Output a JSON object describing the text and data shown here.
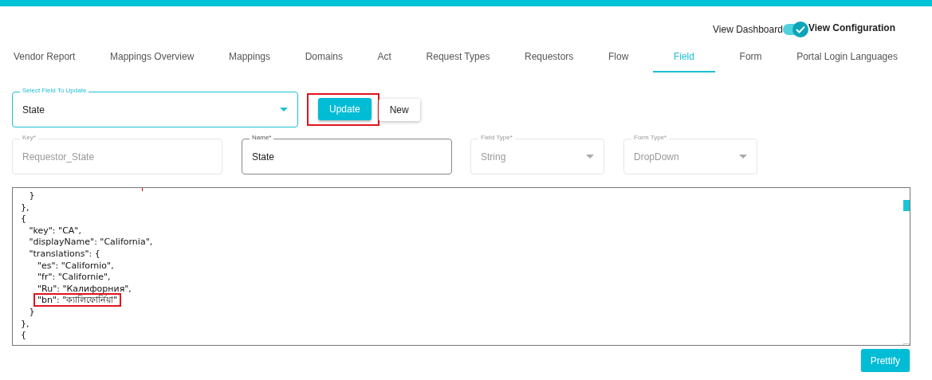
{
  "view_toggle": {
    "left_label": "View Dashboard",
    "right_label": "View Configuration",
    "on": true
  },
  "tabs": [
    {
      "label": "Vendor Report",
      "selected": false
    },
    {
      "label": "Mappings Overview",
      "selected": false
    },
    {
      "label": "Mappings",
      "selected": false
    },
    {
      "label": "Domains",
      "selected": false
    },
    {
      "label": "Act",
      "selected": false
    },
    {
      "label": "Request Types",
      "selected": false
    },
    {
      "label": "Requestors",
      "selected": false
    },
    {
      "label": "Flow",
      "selected": false
    },
    {
      "label": "Field",
      "selected": true
    },
    {
      "label": "Form",
      "selected": false
    },
    {
      "label": "Portal Login Languages",
      "selected": false
    }
  ],
  "field_select": {
    "label": "Select Field To Update",
    "value": "State"
  },
  "buttons": [
    {
      "label": "Update",
      "kind": "primary",
      "highlighted": true
    },
    {
      "label": "New",
      "kind": "secondary",
      "highlighted": false
    }
  ],
  "fields": [
    {
      "label": "Key*",
      "value": "Requestor_State",
      "kind": "text",
      "disabled": true
    },
    {
      "label": "Name*",
      "value": "State",
      "kind": "text",
      "disabled": false
    },
    {
      "label": "Field Type*",
      "value": "String",
      "kind": "select",
      "disabled": true
    },
    {
      "label": "Form Type*",
      "value": "DropDown",
      "kind": "select",
      "disabled": true
    }
  ],
  "editor": {
    "lines": [
      {
        "text": "   }",
        "highlighted": false
      },
      {
        "text": "},",
        "highlighted": false
      },
      {
        "text": "{",
        "highlighted": false
      },
      {
        "text": "   \"key\": \"CA\",",
        "highlighted": false
      },
      {
        "text": "   \"displayName\": \"California\",",
        "highlighted": false
      },
      {
        "text": "   \"translations\": {",
        "highlighted": false
      },
      {
        "text": "      \"es\": \"Californio\",",
        "highlighted": false
      },
      {
        "text": "      \"fr\": \"Californie\",",
        "highlighted": false
      },
      {
        "text": "      \"Ru\": \"Калифорния\",",
        "highlighted": false
      },
      {
        "text": "      \"bn\": \"ক্যালিফোর্নিয়া\"",
        "highlighted": true
      },
      {
        "text": "   }",
        "highlighted": false
      },
      {
        "text": "},",
        "highlighted": false
      },
      {
        "text": "{",
        "highlighted": false
      }
    ]
  },
  "prettify_button": {
    "label": "Prettify"
  }
}
